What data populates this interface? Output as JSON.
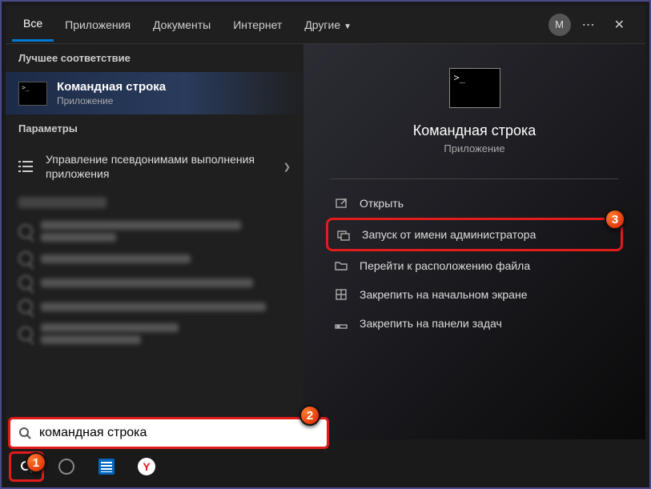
{
  "tabs": {
    "all": "Все",
    "apps": "Приложения",
    "docs": "Документы",
    "web": "Интернет",
    "more": "Другие"
  },
  "avatar_letter": "М",
  "header_more": "⋯",
  "header_close": "✕",
  "left": {
    "best_label": "Лучшее соответствие",
    "best_title": "Командная строка",
    "best_sub": "Приложение",
    "params_label": "Параметры",
    "param1": "Управление псевдонимами выполнения приложения"
  },
  "right": {
    "title": "Командная строка",
    "sub": "Приложение",
    "actions": {
      "open": "Открыть",
      "admin": "Запуск от имени администратора",
      "location": "Перейти к расположению файла",
      "pin_start": "Закрепить на начальном экране",
      "pin_task": "Закрепить на панели задач"
    }
  },
  "search": {
    "value": "командная строка"
  },
  "markers": {
    "m1": "1",
    "m2": "2",
    "m3": "3"
  }
}
